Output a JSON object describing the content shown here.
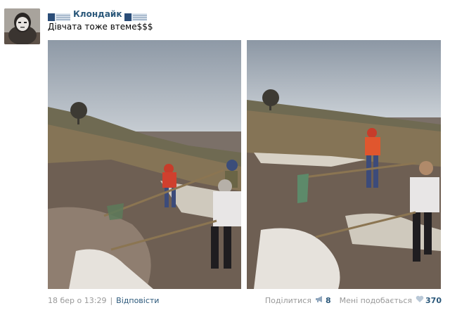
{
  "post": {
    "author": "Клондайк",
    "text": "Дівчата тоже втеме$$$"
  },
  "footer": {
    "date": "18 бер о 13:29",
    "separator": "|",
    "reply_label": "Відповісти",
    "share_label": "Поділитися",
    "share_count": "8",
    "like_label": "Мені подобається",
    "like_count": "370"
  },
  "colors": {
    "link": "#2b587a",
    "muted": "#999999",
    "share_icon": "#8fa6bd",
    "like_icon": "#b9c8d7"
  },
  "icons": {
    "share": "megaphone-icon",
    "like": "heart-icon"
  }
}
